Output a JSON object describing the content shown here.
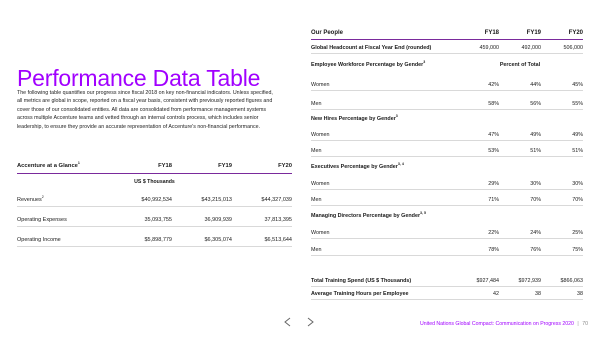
{
  "colors": {
    "accent": "#a100ff",
    "rule": "#7a2a9c"
  },
  "title": "Performance Data Table",
  "intro": "The following table quantifies our progress since fiscal 2018 on key non-financial indicators. Unless specified, all metrics are global in scope, reported on a fiscal year basis, consistent with previously reported figures and cover those of our consolidated entities. All data are consolidated from performance management systems across multiple Accenture teams and vetted through an internal controls process, which includes senior leadership, to ensure they provide an accurate representation of Accenture's non-financial performance.",
  "glance": {
    "title": "Accenture at a Glance",
    "title_sup": "1",
    "years": [
      "FY18",
      "FY19",
      "FY20"
    ],
    "unit": "US $ Thousands",
    "rows": [
      {
        "label": "Revenues",
        "sup": "2",
        "values": [
          "$40,992,534",
          "$43,215,013",
          "$44,327,039"
        ]
      },
      {
        "label": "Operating Expenses",
        "sup": "",
        "values": [
          "35,093,755",
          "36,909,939",
          "37,813,395"
        ]
      },
      {
        "label": "Operating Income",
        "sup": "",
        "values": [
          "$5,898,779",
          "$6,305,074",
          "$6,513,644"
        ]
      }
    ]
  },
  "people": {
    "title": "Our People",
    "years": [
      "FY18",
      "FY19",
      "FY20"
    ],
    "headcount": {
      "label": "Global Headcount at Fiscal Year End (rounded)",
      "values": [
        "459,000",
        "492,000",
        "506,000"
      ]
    },
    "workforce": {
      "label": "Employee Workforce Percentage by Gender",
      "sup": "3",
      "span": "Percent of Total",
      "rows": [
        {
          "label": "Women",
          "values": [
            "42%",
            "44%",
            "45%"
          ]
        },
        {
          "label": "Men",
          "values": [
            "58%",
            "56%",
            "55%"
          ]
        }
      ]
    },
    "hires": {
      "label": "New Hires Percentage by Gender",
      "sup": "3",
      "rows": [
        {
          "label": "Women",
          "values": [
            "47%",
            "49%",
            "49%"
          ]
        },
        {
          "label": "Men",
          "values": [
            "53%",
            "51%",
            "51%"
          ]
        }
      ]
    },
    "executives": {
      "label": "Executives Percentage by Gender",
      "sup": "3, 4",
      "rows": [
        {
          "label": "Women",
          "values": [
            "29%",
            "30%",
            "30%"
          ]
        },
        {
          "label": "Men",
          "values": [
            "71%",
            "70%",
            "70%"
          ]
        }
      ]
    },
    "managing": {
      "label": "Managing Directors Percentage by Gender",
      "sup": "3, 5",
      "rows": [
        {
          "label": "Women",
          "values": [
            "22%",
            "24%",
            "25%"
          ]
        },
        {
          "label": "Men",
          "values": [
            "78%",
            "76%",
            "75%"
          ]
        }
      ]
    },
    "training_spend": {
      "label": "Total Training Spend (US $ Thousands)",
      "values": [
        "$927,484",
        "$972,939",
        "$866,063"
      ]
    },
    "training_hours": {
      "label": "Average Training Hours per Employee",
      "values": [
        "42",
        "38",
        "38"
      ]
    }
  },
  "footer": {
    "text": "United Nations Global Compact: Communication on Progress 2020",
    "separator": "|",
    "page": "70"
  },
  "nav": {
    "prev_icon": "chevron-left-icon",
    "next_icon": "chevron-right-icon"
  }
}
